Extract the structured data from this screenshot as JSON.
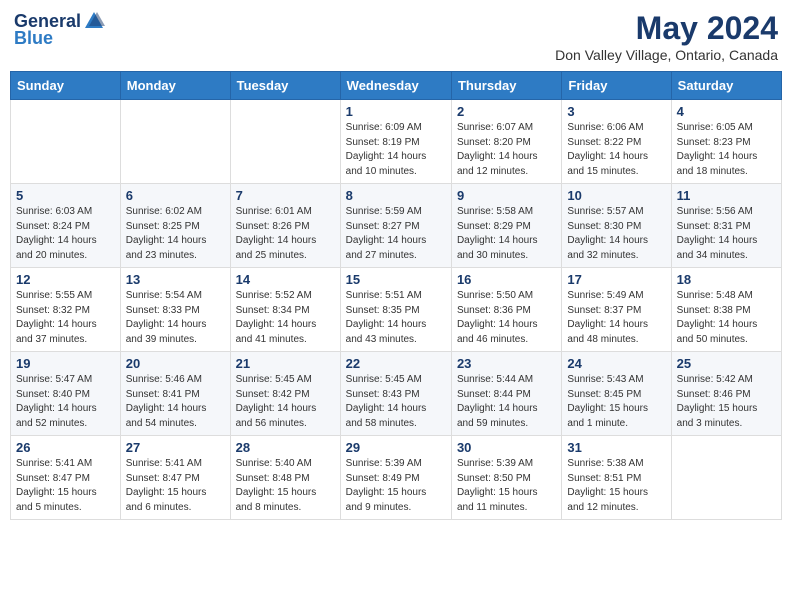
{
  "header": {
    "logo_general": "General",
    "logo_blue": "Blue",
    "month_title": "May 2024",
    "subtitle": "Don Valley Village, Ontario, Canada"
  },
  "weekdays": [
    "Sunday",
    "Monday",
    "Tuesday",
    "Wednesday",
    "Thursday",
    "Friday",
    "Saturday"
  ],
  "weeks": [
    [
      {
        "day": "",
        "info": ""
      },
      {
        "day": "",
        "info": ""
      },
      {
        "day": "",
        "info": ""
      },
      {
        "day": "1",
        "info": "Sunrise: 6:09 AM\nSunset: 8:19 PM\nDaylight: 14 hours\nand 10 minutes."
      },
      {
        "day": "2",
        "info": "Sunrise: 6:07 AM\nSunset: 8:20 PM\nDaylight: 14 hours\nand 12 minutes."
      },
      {
        "day": "3",
        "info": "Sunrise: 6:06 AM\nSunset: 8:22 PM\nDaylight: 14 hours\nand 15 minutes."
      },
      {
        "day": "4",
        "info": "Sunrise: 6:05 AM\nSunset: 8:23 PM\nDaylight: 14 hours\nand 18 minutes."
      }
    ],
    [
      {
        "day": "5",
        "info": "Sunrise: 6:03 AM\nSunset: 8:24 PM\nDaylight: 14 hours\nand 20 minutes."
      },
      {
        "day": "6",
        "info": "Sunrise: 6:02 AM\nSunset: 8:25 PM\nDaylight: 14 hours\nand 23 minutes."
      },
      {
        "day": "7",
        "info": "Sunrise: 6:01 AM\nSunset: 8:26 PM\nDaylight: 14 hours\nand 25 minutes."
      },
      {
        "day": "8",
        "info": "Sunrise: 5:59 AM\nSunset: 8:27 PM\nDaylight: 14 hours\nand 27 minutes."
      },
      {
        "day": "9",
        "info": "Sunrise: 5:58 AM\nSunset: 8:29 PM\nDaylight: 14 hours\nand 30 minutes."
      },
      {
        "day": "10",
        "info": "Sunrise: 5:57 AM\nSunset: 8:30 PM\nDaylight: 14 hours\nand 32 minutes."
      },
      {
        "day": "11",
        "info": "Sunrise: 5:56 AM\nSunset: 8:31 PM\nDaylight: 14 hours\nand 34 minutes."
      }
    ],
    [
      {
        "day": "12",
        "info": "Sunrise: 5:55 AM\nSunset: 8:32 PM\nDaylight: 14 hours\nand 37 minutes."
      },
      {
        "day": "13",
        "info": "Sunrise: 5:54 AM\nSunset: 8:33 PM\nDaylight: 14 hours\nand 39 minutes."
      },
      {
        "day": "14",
        "info": "Sunrise: 5:52 AM\nSunset: 8:34 PM\nDaylight: 14 hours\nand 41 minutes."
      },
      {
        "day": "15",
        "info": "Sunrise: 5:51 AM\nSunset: 8:35 PM\nDaylight: 14 hours\nand 43 minutes."
      },
      {
        "day": "16",
        "info": "Sunrise: 5:50 AM\nSunset: 8:36 PM\nDaylight: 14 hours\nand 46 minutes."
      },
      {
        "day": "17",
        "info": "Sunrise: 5:49 AM\nSunset: 8:37 PM\nDaylight: 14 hours\nand 48 minutes."
      },
      {
        "day": "18",
        "info": "Sunrise: 5:48 AM\nSunset: 8:38 PM\nDaylight: 14 hours\nand 50 minutes."
      }
    ],
    [
      {
        "day": "19",
        "info": "Sunrise: 5:47 AM\nSunset: 8:40 PM\nDaylight: 14 hours\nand 52 minutes."
      },
      {
        "day": "20",
        "info": "Sunrise: 5:46 AM\nSunset: 8:41 PM\nDaylight: 14 hours\nand 54 minutes."
      },
      {
        "day": "21",
        "info": "Sunrise: 5:45 AM\nSunset: 8:42 PM\nDaylight: 14 hours\nand 56 minutes."
      },
      {
        "day": "22",
        "info": "Sunrise: 5:45 AM\nSunset: 8:43 PM\nDaylight: 14 hours\nand 58 minutes."
      },
      {
        "day": "23",
        "info": "Sunrise: 5:44 AM\nSunset: 8:44 PM\nDaylight: 14 hours\nand 59 minutes."
      },
      {
        "day": "24",
        "info": "Sunrise: 5:43 AM\nSunset: 8:45 PM\nDaylight: 15 hours\nand 1 minute."
      },
      {
        "day": "25",
        "info": "Sunrise: 5:42 AM\nSunset: 8:46 PM\nDaylight: 15 hours\nand 3 minutes."
      }
    ],
    [
      {
        "day": "26",
        "info": "Sunrise: 5:41 AM\nSunset: 8:47 PM\nDaylight: 15 hours\nand 5 minutes."
      },
      {
        "day": "27",
        "info": "Sunrise: 5:41 AM\nSunset: 8:47 PM\nDaylight: 15 hours\nand 6 minutes."
      },
      {
        "day": "28",
        "info": "Sunrise: 5:40 AM\nSunset: 8:48 PM\nDaylight: 15 hours\nand 8 minutes."
      },
      {
        "day": "29",
        "info": "Sunrise: 5:39 AM\nSunset: 8:49 PM\nDaylight: 15 hours\nand 9 minutes."
      },
      {
        "day": "30",
        "info": "Sunrise: 5:39 AM\nSunset: 8:50 PM\nDaylight: 15 hours\nand 11 minutes."
      },
      {
        "day": "31",
        "info": "Sunrise: 5:38 AM\nSunset: 8:51 PM\nDaylight: 15 hours\nand 12 minutes."
      },
      {
        "day": "",
        "info": ""
      }
    ]
  ]
}
